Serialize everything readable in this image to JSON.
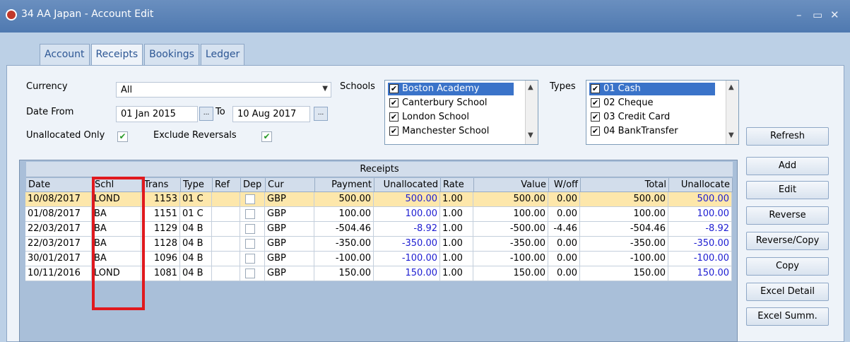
{
  "window": {
    "title": "34 AA Japan - Account Edit",
    "minimize": "–",
    "maximize": "▭",
    "close": "✕"
  },
  "tabs": [
    "Account",
    "Receipts",
    "Bookings",
    "Ledger"
  ],
  "filters": {
    "currency_label": "Currency",
    "currency_value": "All",
    "date_from_label": "Date From",
    "date_from": "01 Jan 2015",
    "to_label": "To",
    "date_to": "10 Aug 2017",
    "picker": "...",
    "unallocated_only_label": "Unallocated Only",
    "exclude_reversals_label": "Exclude Reversals",
    "schools_label": "Schools",
    "types_label": "Types"
  },
  "schools": [
    "Boston Academy",
    "Canterbury School",
    "London School",
    "Manchester School"
  ],
  "types": [
    "01 Cash",
    "02 Cheque",
    "03 Credit Card",
    "04 BankTransfer"
  ],
  "buttons": {
    "refresh": "Refresh",
    "add": "Add",
    "edit": "Edit",
    "reverse": "Reverse",
    "reverse_copy": "Reverse/Copy",
    "copy": "Copy",
    "excel_detail": "Excel Detail",
    "excel_summ": "Excel Summ."
  },
  "grid": {
    "title": "Receipts",
    "headers": [
      "Date",
      "Schl",
      "Trans",
      "Type",
      "Ref",
      "Dep",
      "Cur",
      "Payment",
      "Unallocated",
      "Rate",
      "Value",
      "W/off",
      "Total",
      "Unallocate"
    ],
    "rows": [
      [
        "10/08/2017",
        "LOND",
        "1153",
        "01 C",
        "",
        "",
        "GBP",
        "500.00",
        "500.00",
        "1.00",
        "500.00",
        "0.00",
        "500.00",
        "500.00"
      ],
      [
        "01/08/2017",
        "BA",
        "1151",
        "01 C",
        "",
        "",
        "GBP",
        "100.00",
        "100.00",
        "1.00",
        "100.00",
        "0.00",
        "100.00",
        "100.00"
      ],
      [
        "22/03/2017",
        "BA",
        "1129",
        "04 B",
        "",
        "",
        "GBP",
        "-504.46",
        "-8.92",
        "1.00",
        "-500.00",
        "-4.46",
        "-504.46",
        "-8.92"
      ],
      [
        "22/03/2017",
        "BA",
        "1128",
        "04 B",
        "",
        "",
        "GBP",
        "-350.00",
        "-350.00",
        "1.00",
        "-350.00",
        "0.00",
        "-350.00",
        "-350.00"
      ],
      [
        "30/01/2017",
        "BA",
        "1096",
        "04 B",
        "",
        "",
        "GBP",
        "-100.00",
        "-100.00",
        "1.00",
        "-100.00",
        "0.00",
        "-100.00",
        "-100.00"
      ],
      [
        "10/11/2016",
        "LOND",
        "1081",
        "04 B",
        "",
        "",
        "GBP",
        "150.00",
        "150.00",
        "1.00",
        "150.00",
        "0.00",
        "150.00",
        "150.00"
      ]
    ]
  }
}
